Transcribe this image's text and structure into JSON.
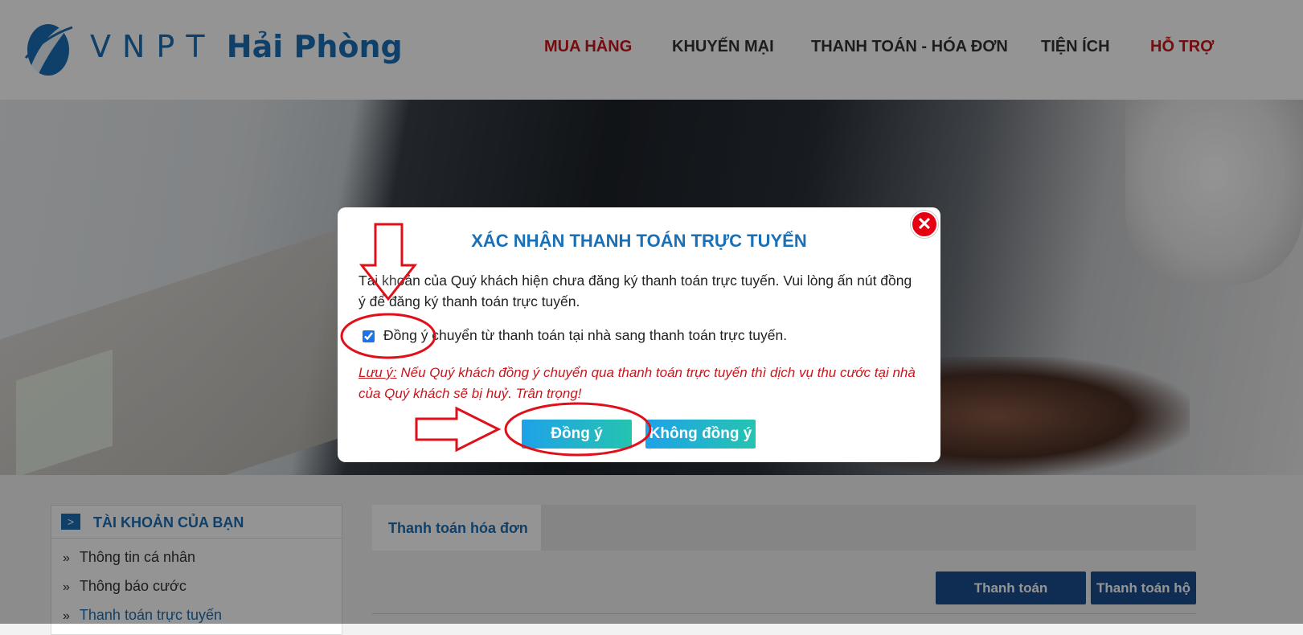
{
  "header": {
    "logo_text_vnpt": "VNPT",
    "logo_text_city": "Hải Phòng",
    "nav": [
      {
        "label": "MUA HÀNG",
        "color": "#c8161d"
      },
      {
        "label": "KHUYẾN MẠI",
        "color": "#333333"
      },
      {
        "label": "THANH TOÁN - HÓA ĐƠN",
        "color": "#333333"
      },
      {
        "label": "TIỆN ÍCH",
        "color": "#333333"
      },
      {
        "label": "HỖ TRỢ",
        "color": "#c8161d"
      }
    ]
  },
  "sidebar": {
    "title": "TÀI KHOẢN CỦA BẠN",
    "items": [
      {
        "label": "Thông tin cá nhân"
      },
      {
        "label": "Thông báo cước"
      },
      {
        "label": "Thanh toán trực tuyến",
        "active": true
      }
    ]
  },
  "content": {
    "active_tab": "Thanh toán hóa đơn",
    "buttons": {
      "pay": "Thanh toán",
      "pay_for": "Thanh toán hộ"
    }
  },
  "modal": {
    "title": "XÁC NHẬN THANH TOÁN TRỰC TUYẾN",
    "body": "Tài khoản của Quý khách hiện chưa đăng ký thanh toán trực tuyến. Vui lòng ấn nút đồng ý để đăng ký thanh toán trực tuyến.",
    "checkbox_label": "Đồng ý chuyển từ thanh toán tại nhà sang thanh toán trực tuyến.",
    "checkbox_checked": true,
    "note_label": "Lưu ý:",
    "note_text": " Nếu Quý khách đồng ý chuyển qua thanh toán trực tuyến thì dịch vụ thu cước tại nhà của Quý khách sẽ bị huỷ. Trân trọng!",
    "agree_button": "Đồng ý",
    "disagree_button": "Không đồng ý",
    "close_glyph": "✕"
  },
  "colors": {
    "brand_blue": "#1a6fb5",
    "alert_red": "#c8161d",
    "annotation_red": "#e0101a"
  }
}
